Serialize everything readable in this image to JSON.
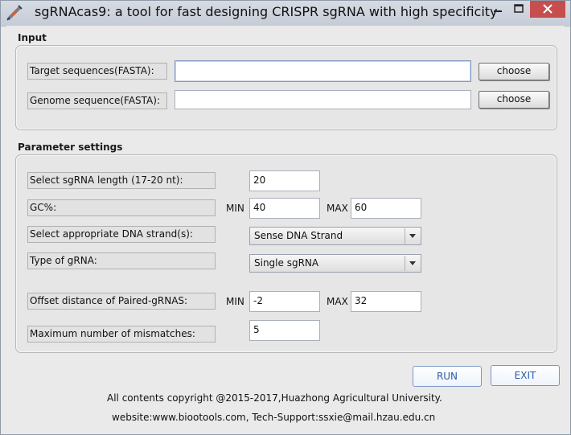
{
  "window": {
    "title": "sgRNAcas9: a tool for fast designing CRISPR sgRNA with high specificity",
    "icon": "syringe-icon",
    "controls": [
      "minimize-icon",
      "maximize-icon",
      "close-icon"
    ]
  },
  "input_section": {
    "title": "Input",
    "target_label": "Target sequences(FASTA):",
    "target_value": "",
    "genome_label": "Genome sequence(FASTA):",
    "genome_value": "",
    "choose_label": "choose"
  },
  "params": {
    "title": "Parameter settings",
    "length_label": "Select sgRNA length (17-20 nt):",
    "length_value": "20",
    "gc_label": "GC%:",
    "gc_min": "40",
    "gc_max": "60",
    "strand_label": "Select appropriate DNA strand(s):",
    "strand_value": "Sense DNA Strand",
    "grna_type_label": "Type of gRNA:",
    "grna_type_value": "Single sgRNA",
    "offset_label": "Offset distance of Paired-gRNAS:",
    "offset_min": "-2",
    "offset_max": "32",
    "mismatch_label": "Maximum number of mismatches:",
    "mismatch_value": "5",
    "min_label": "MIN",
    "max_label": "MAX"
  },
  "actions": {
    "run_label": "RUN",
    "exit_label": "EXIT"
  },
  "footer": {
    "copyright": "All contents copyright @2015-2017,Huazhong Agricultural University.",
    "website": "website:www.biootools.com, Tech-Support:ssxie@mail.hzau.edu.cn"
  },
  "colors": {
    "titlebar": "#c9cfd8",
    "close_button": "#c74e4e",
    "action_text": "#2c5aa8"
  }
}
